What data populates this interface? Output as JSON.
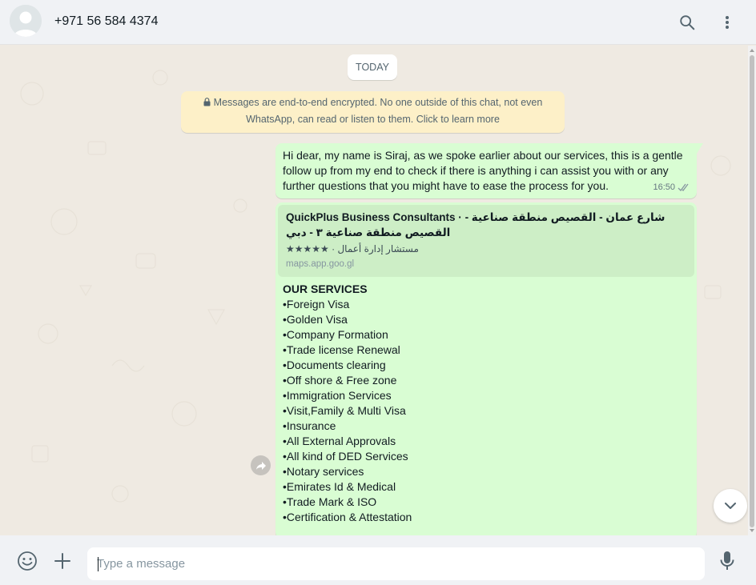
{
  "header": {
    "contact_name": "+971 56 584 4374",
    "icons": {
      "avatar": "default-avatar-icon",
      "search": "search-icon",
      "menu": "kebab-menu-icon"
    }
  },
  "chat": {
    "date_chip": "TODAY",
    "encryption_notice": "Messages are end-to-end encrypted. No one outside of this chat, not even WhatsApp, can read or listen to them. Click to learn more",
    "messages": [
      {
        "text": "Hi dear, my name is Siraj, as we spoke earlier about our services, this is a gentle follow up from my end to check if there is anything i can assist you with or any further questions that you might have to ease the process for you.",
        "time": "16:50",
        "status": "delivered"
      }
    ],
    "link_preview": {
      "title": "QuickPlus Business Consultants · شارع عمان - القصيص منطقة صناعية - القصيص منطقة صناعية ٣ - دبي",
      "description": "مستشار إدارة أعمال · ★★★★★",
      "domain": "maps.app.goo.gl"
    },
    "services": {
      "title": "OUR SERVICES",
      "items": [
        "•Foreign Visa",
        "•Golden Visa",
        "•Company Formation",
        "•Trade license Renewal",
        "•Documents clearing",
        "•Off shore & Free zone",
        "•Immigration Services",
        "•Visit,Family & Multi Visa",
        "•Insurance",
        "•All External Approvals",
        "•All kind of DED Services",
        "•Notary services",
        "•Emirates Id & Medical",
        "•Trade Mark & ISO",
        "•Certification & Attestation"
      ]
    }
  },
  "composer": {
    "placeholder": "Type a message",
    "icons": {
      "emoji": "emoji-icon",
      "attach": "plus-icon",
      "voice": "microphone-icon"
    }
  },
  "colors": {
    "outgoing_bubble": "#d9fdd3",
    "link_card": "#cdeec6",
    "chat_background": "#efeae2",
    "notice_background": "#fdf0c8",
    "header_background": "#f0f2f5",
    "read_ticks": "#8696a0"
  }
}
